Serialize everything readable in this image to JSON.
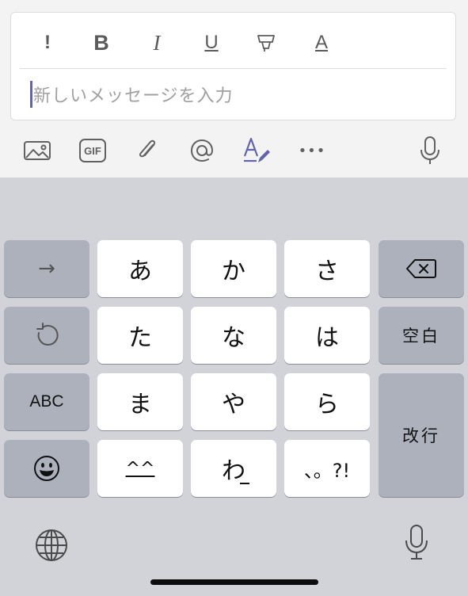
{
  "formatting": {
    "important": "!",
    "bold": "B",
    "italic": "I",
    "underline": "U",
    "highlight_icon": "highlighter-icon",
    "font_color": "A"
  },
  "message": {
    "placeholder": "新しいメッセージを入力"
  },
  "toolbar": {
    "icons": [
      "image-icon",
      "gif-icon",
      "attach-icon",
      "mention-icon",
      "format-icon",
      "more-icon",
      "mic-icon"
    ],
    "gif_label": "GIF",
    "more_label": "•••",
    "format_accent": "#6264a7"
  },
  "keyboard": {
    "row1": [
      "あ",
      "か",
      "さ"
    ],
    "row2": [
      "た",
      "な",
      "は"
    ],
    "row3": [
      "ま",
      "や",
      "ら"
    ],
    "row4": [
      "^^",
      "わ",
      "、。?!"
    ],
    "abc": "ABC",
    "space": "空白",
    "return": "改行",
    "arrow": "→",
    "undo_icon": "undo-icon",
    "delete_icon": "delete-icon",
    "emoji_icon": "emoji-icon",
    "globe_icon": "globe-icon",
    "dictation_icon": "mic-icon"
  },
  "colors": {
    "accent": "#6264a7",
    "keyboard_bg": "#d1d3d9",
    "key_white": "#ffffff",
    "key_gray": "#acb1bb"
  }
}
